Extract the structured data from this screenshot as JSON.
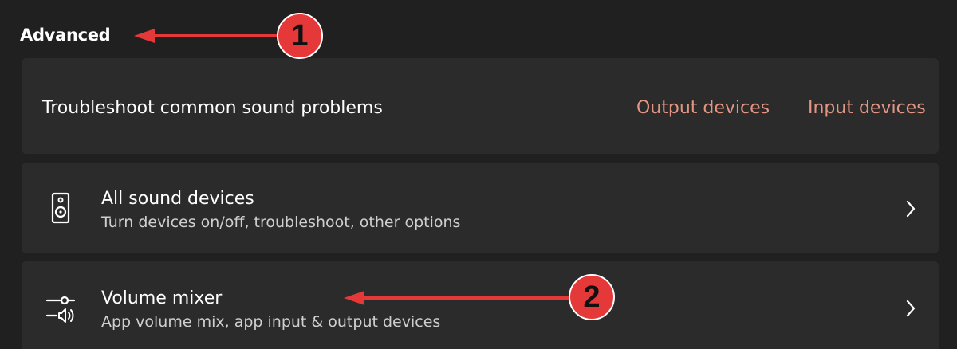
{
  "section": {
    "title": "Advanced"
  },
  "troubleshoot": {
    "label": "Troubleshoot common sound problems",
    "links": {
      "output": "Output devices",
      "input": "Input devices"
    },
    "link_color": "#e49683"
  },
  "rows": [
    {
      "title": "All sound devices",
      "subtitle": "Turn devices on/off, troubleshoot, other options",
      "icon": "speaker-icon"
    },
    {
      "title": "Volume mixer",
      "subtitle": "App volume mix, app input & output devices",
      "icon": "volume-mixer-icon"
    }
  ],
  "annotations": {
    "badge1": "1",
    "badge2": "2",
    "color": "#e53838"
  }
}
